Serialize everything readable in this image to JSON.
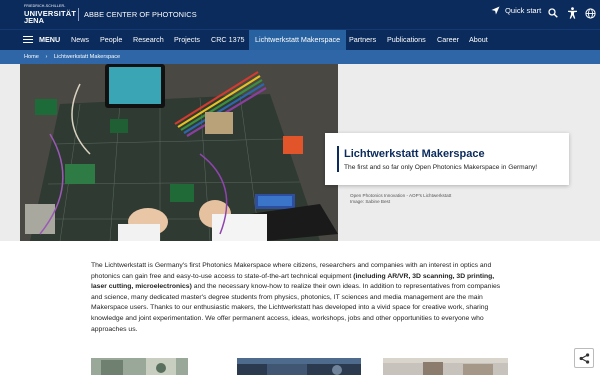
{
  "header": {
    "logo_small": "FRIEDRICH-SCHILLER-",
    "logo_big": "UNIVERSITÄT",
    "logo_jena": "JENA",
    "center_name": "ABBE CENTER OF PHOTONICS",
    "quickstart_label": "Quick start",
    "icons": [
      "location-arrow-icon",
      "search-icon",
      "accessibility-icon",
      "globe-icon"
    ]
  },
  "nav": {
    "menu_label": "MENU",
    "items": [
      {
        "label": "News"
      },
      {
        "label": "People"
      },
      {
        "label": "Research"
      },
      {
        "label": "Projects"
      },
      {
        "label": "CRC 1375"
      },
      {
        "label": "Lichtwerkstatt Makerspace",
        "active": true
      },
      {
        "label": "Partners"
      },
      {
        "label": "Publications"
      },
      {
        "label": "Career"
      },
      {
        "label": "About"
      }
    ]
  },
  "breadcrumb": {
    "home": "Home",
    "separator": "›",
    "current": "Lichtwerkstatt Makerspace"
  },
  "hero": {
    "title": "Lichtwerkstatt Makerspace",
    "subtitle": "The first and so far only Open Photonics Makerspace in Germany!",
    "caption_line1": "Open Photonics Innovation - AOP's Lichtwerkstatt",
    "caption_line2": "Image: Sabine Best"
  },
  "body": {
    "part1": "The Lichtwerkstatt is Germany's first Photonics Makerspace where citizens, researchers and companies with an interest in optics and photonics can gain free and easy-to-use access to state-of-the-art technical equipment ",
    "bold": "(including AR/VR, 3D scanning, 3D printing, laser cutting, microelectronics)",
    "part2": " and the necessary know-how to realize their own ideas. In addition to representatives from companies and science, many dedicated master's degree students from physics, photonics, IT sciences and media management are the main Makerspace users. Thanks to our enthusiastic makers, the Lichtwerkstatt has developed into a vivid space for creative work, sharing knowledge and joint experimentation. We offer permanent access, ideas, workshops, jobs and other opportunities to everyone who approaches us."
  },
  "colors": {
    "navy": "#0a2b5c",
    "active_nav": "#27619f",
    "breadcrumb_bar": "#2e66a8"
  }
}
